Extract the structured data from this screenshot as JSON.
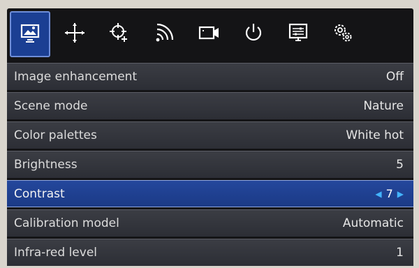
{
  "toolbar": {
    "icons": [
      {
        "name": "image-icon",
        "active": true
      },
      {
        "name": "crosshair-move-icon",
        "active": false
      },
      {
        "name": "target-calibrate-icon",
        "active": false
      },
      {
        "name": "wifi-icon",
        "active": false
      },
      {
        "name": "video-camera-icon",
        "active": false
      },
      {
        "name": "power-icon",
        "active": false
      },
      {
        "name": "display-settings-icon",
        "active": false
      },
      {
        "name": "settings-gears-icon",
        "active": false
      }
    ]
  },
  "menu": {
    "items": [
      {
        "label": "Image enhancement",
        "value": "Off"
      },
      {
        "label": "Scene mode",
        "value": "Nature"
      },
      {
        "label": "Color palettes",
        "value": "White hot"
      },
      {
        "label": "Brightness",
        "value": "5"
      },
      {
        "label": "Contrast",
        "value": "7",
        "selected": true
      },
      {
        "label": "Calibration model",
        "value": "Automatic"
      },
      {
        "label": "Infra-red level",
        "value": "1"
      }
    ]
  },
  "colors": {
    "background": "#141416",
    "row": "#34363d",
    "selected": "#1f4190",
    "accent_arrow": "#43b4ff"
  }
}
